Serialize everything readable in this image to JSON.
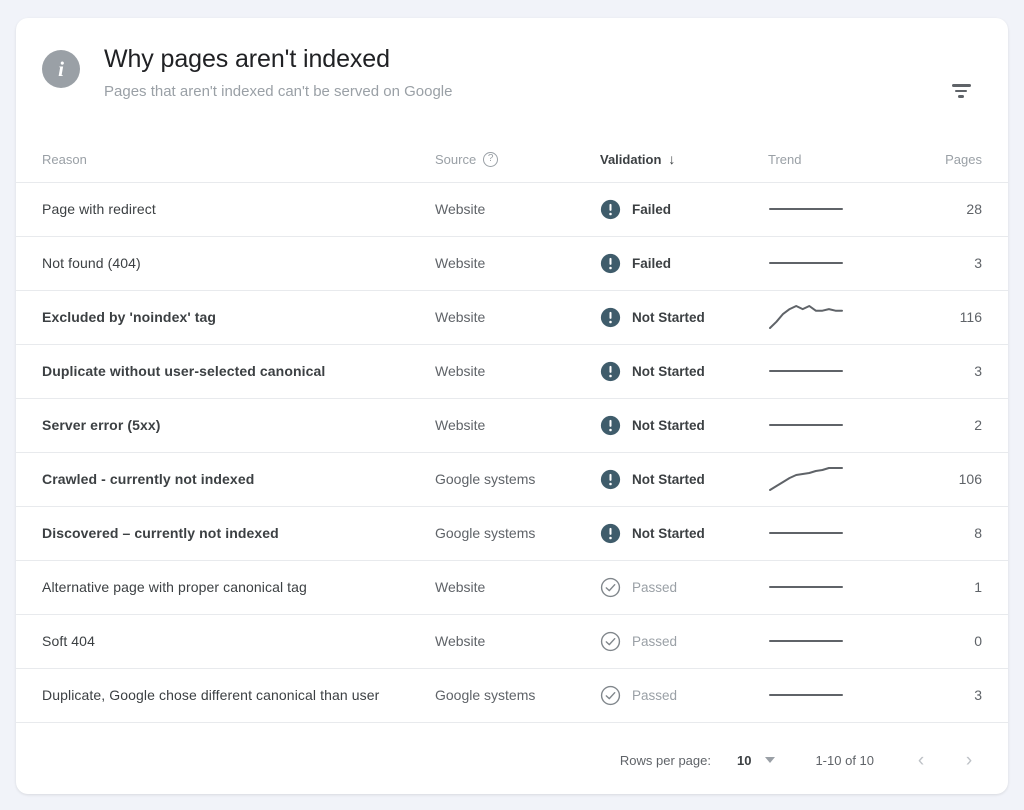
{
  "header": {
    "icon": "info-icon",
    "title": "Why pages aren't indexed",
    "subtitle": "Pages that aren't indexed can't be served on Google",
    "filter_icon": "filter-icon"
  },
  "table": {
    "columns": [
      {
        "key": "reason",
        "label": "Reason",
        "align": "left",
        "active": false
      },
      {
        "key": "source",
        "label": "Source",
        "align": "left",
        "active": false,
        "help_icon": "help-icon"
      },
      {
        "key": "validation",
        "label": "Validation",
        "align": "left",
        "active": true,
        "sort_icon": "arrow-down-icon"
      },
      {
        "key": "trend",
        "label": "Trend",
        "align": "left",
        "active": false
      },
      {
        "key": "pages",
        "label": "Pages",
        "align": "right",
        "active": false
      }
    ],
    "rows": [
      {
        "reason": "Page with redirect",
        "bold": false,
        "source": "Website",
        "validation": "Failed",
        "status": "failed",
        "status_icon": "error-exclamation-icon",
        "trend": [
          50,
          50,
          50,
          50,
          50,
          50,
          50,
          50,
          50,
          50,
          50,
          50
        ],
        "pages": "28"
      },
      {
        "reason": "Not found (404)",
        "bold": false,
        "source": "Website",
        "validation": "Failed",
        "status": "failed",
        "status_icon": "error-exclamation-icon",
        "trend": [
          50,
          50,
          50,
          50,
          50,
          50,
          50,
          50,
          50,
          50,
          50,
          50
        ],
        "pages": "3"
      },
      {
        "reason": "Excluded by 'noindex' tag",
        "bold": true,
        "source": "Website",
        "validation": "Not Started",
        "status": "not-started",
        "status_icon": "error-exclamation-icon",
        "trend": [
          34,
          42,
          52,
          58,
          62,
          58,
          62,
          56,
          56,
          58,
          56,
          56
        ],
        "pages": "116"
      },
      {
        "reason": "Duplicate without user-selected canonical",
        "bold": true,
        "source": "Website",
        "validation": "Not Started",
        "status": "not-started",
        "status_icon": "error-exclamation-icon",
        "trend": [
          50,
          50,
          50,
          50,
          50,
          50,
          50,
          50,
          50,
          50,
          50,
          50
        ],
        "pages": "3"
      },
      {
        "reason": "Server error (5xx)",
        "bold": true,
        "source": "Website",
        "validation": "Not Started",
        "status": "not-started",
        "status_icon": "error-exclamation-icon",
        "trend": [
          50,
          50,
          50,
          50,
          50,
          50,
          50,
          50,
          50,
          50,
          50,
          50
        ],
        "pages": "2"
      },
      {
        "reason": "Crawled - currently not indexed",
        "bold": true,
        "source": "Google systems",
        "validation": "Not Started",
        "status": "not-started",
        "status_icon": "error-exclamation-icon",
        "trend": [
          22,
          30,
          38,
          46,
          52,
          54,
          56,
          60,
          62,
          66,
          66,
          66
        ],
        "pages": "106"
      },
      {
        "reason": "Discovered – currently not indexed",
        "bold": true,
        "source": "Google systems",
        "validation": "Not Started",
        "status": "not-started",
        "status_icon": "error-exclamation-icon",
        "trend": [
          50,
          50,
          50,
          50,
          50,
          50,
          50,
          50,
          50,
          50,
          50,
          50
        ],
        "pages": "8"
      },
      {
        "reason": "Alternative page with proper canonical tag",
        "bold": false,
        "source": "Website",
        "validation": "Passed",
        "status": "passed",
        "status_icon": "check-circle-icon",
        "trend": [
          50,
          50,
          50,
          50,
          50,
          50,
          50,
          50,
          50,
          50,
          50,
          50
        ],
        "pages": "1"
      },
      {
        "reason": "Soft 404",
        "bold": false,
        "source": "Website",
        "validation": "Passed",
        "status": "passed",
        "status_icon": "check-circle-icon",
        "trend": [
          50,
          50,
          50,
          50,
          50,
          50,
          50,
          50,
          50,
          50,
          50,
          50
        ],
        "pages": "0"
      },
      {
        "reason": "Duplicate, Google chose different canonical than user",
        "bold": false,
        "source": "Google systems",
        "validation": "Passed",
        "status": "passed",
        "status_icon": "check-circle-icon",
        "trend": [
          50,
          50,
          50,
          50,
          50,
          50,
          50,
          50,
          50,
          50,
          50,
          50
        ],
        "pages": "3"
      }
    ]
  },
  "footer": {
    "rows_per_page_label": "Rows per page:",
    "rows_per_page_value": "10",
    "caret_icon": "chevron-down-icon",
    "range_label": "1-10 of 10",
    "prev_icon": "chevron-left-icon",
    "next_icon": "chevron-right-icon",
    "prev_glyph": "‹",
    "next_glyph": "›"
  },
  "colors": {
    "page_background": "#f1f3f9",
    "card_background": "#ffffff",
    "error_icon": "#3f5c6b",
    "passed_icon": "#80868b",
    "divider": "#e8eaed",
    "text_primary": "#3c4043",
    "text_secondary": "#5f6368",
    "text_muted": "#9aa0a6",
    "trend_line": "#5f6368"
  }
}
